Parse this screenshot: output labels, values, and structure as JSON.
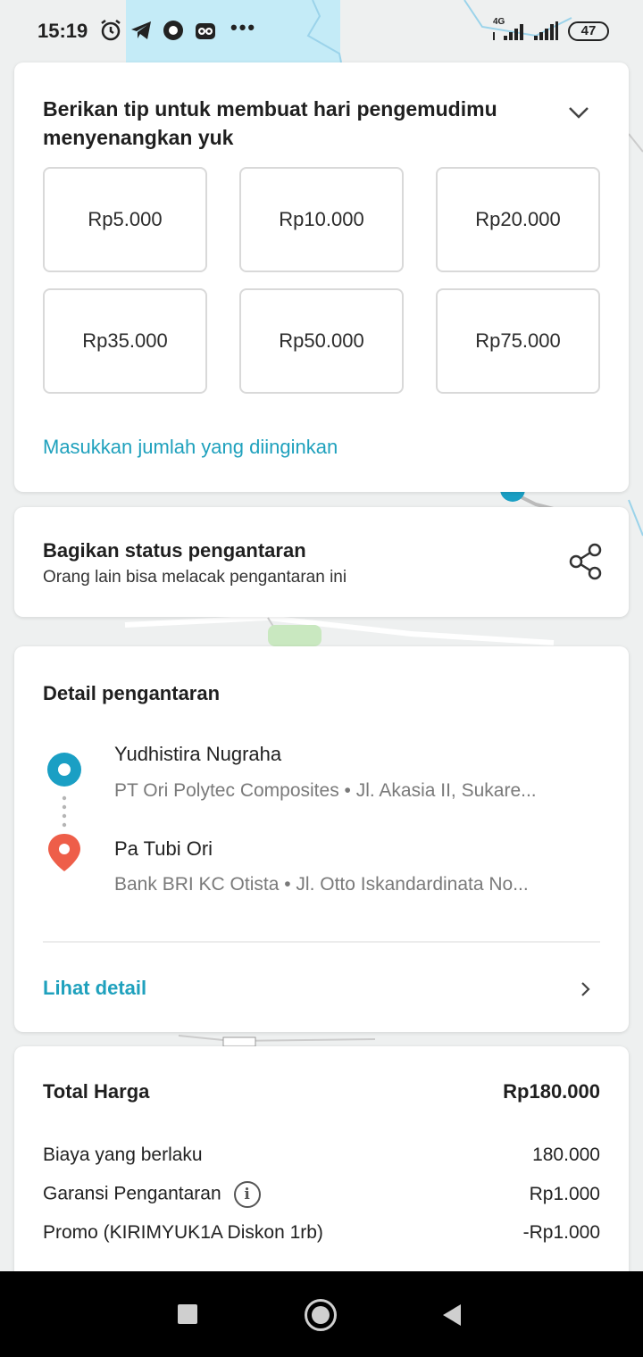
{
  "status_bar": {
    "time": "15:19",
    "battery": "47",
    "network": "4G",
    "icons": [
      "alarm-icon",
      "telegram-icon",
      "app-icon",
      "tripadvisor-icon",
      "more-icon"
    ]
  },
  "tip": {
    "title": "Berikan tip untuk membuat hari pengemudimu menyenangkan yuk",
    "options": [
      "Rp5.000",
      "Rp10.000",
      "Rp20.000",
      "Rp35.000",
      "Rp50.000",
      "Rp75.000"
    ],
    "custom_label": "Masukkan jumlah yang diinginkan"
  },
  "share": {
    "title": "Bagikan status pengantaran",
    "subtitle": "Orang lain bisa melacak pengantaran ini"
  },
  "detail": {
    "title": "Detail pengantaran",
    "stops": [
      {
        "name": "Yudhistira Nugraha",
        "address": "PT Ori Polytec Composites  •  Jl. Akasia II, Sukare..."
      },
      {
        "name": "Pa Tubi Ori",
        "address": "Bank BRI KC Otista  •  Jl. Otto Iskandardinata No..."
      }
    ],
    "link_label": "Lihat detail"
  },
  "price": {
    "total_label": "Total Harga",
    "total_value": "Rp180.000",
    "rows": [
      {
        "label": "Biaya yang berlaku",
        "value": "180.000"
      },
      {
        "label": "Garansi Pengantaran",
        "value": "Rp1.000"
      },
      {
        "label": "Promo (KIRIMYUK1A Diskon 1rb)",
        "value": "-Rp1.000"
      }
    ]
  },
  "colors": {
    "accent": "#1fa1bd",
    "pickup": "#1a9fc4",
    "dropoff": "#ee5e49"
  }
}
